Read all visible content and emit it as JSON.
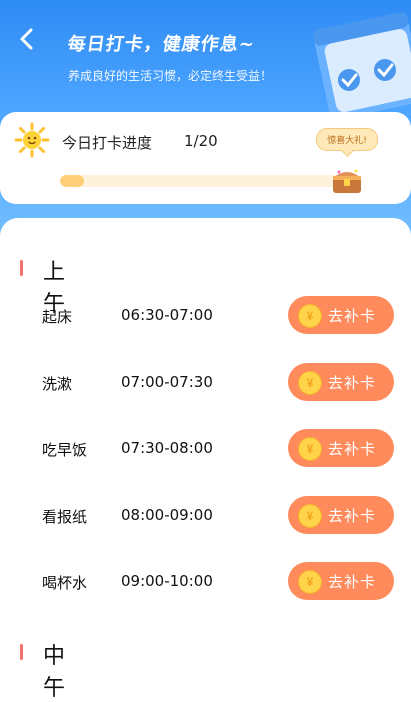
{
  "header": {
    "title": "每日打卡，健康作息~",
    "subtitle": "养成良好的生活习惯，必定终生受益！"
  },
  "progress": {
    "label": "今日打卡进度",
    "value_text": "1/20",
    "fraction": 0.05,
    "gift_text": "惊喜大礼!"
  },
  "sections": [
    {
      "title": "上午",
      "items": [
        {
          "name": "起床",
          "time": "06:30-07:00",
          "button": "去补卡",
          "coin": "¥"
        },
        {
          "name": "洗漱",
          "time": "07:00-07:30",
          "button": "去补卡",
          "coin": "¥"
        },
        {
          "name": "吃早饭",
          "time": "07:30-08:00",
          "button": "去补卡",
          "coin": "¥"
        },
        {
          "name": "看报纸",
          "time": "08:00-09:00",
          "button": "去补卡",
          "coin": "¥"
        },
        {
          "name": "喝杯水",
          "time": "09:00-10:00",
          "button": "去补卡",
          "coin": "¥"
        }
      ]
    },
    {
      "title": "中午",
      "items": []
    }
  ],
  "colors": {
    "header_top": "#2f8cf5",
    "accent_orange": "#ff8a5c",
    "section_marker": "#f1726b",
    "progress_fill": "#ffcf7a"
  }
}
